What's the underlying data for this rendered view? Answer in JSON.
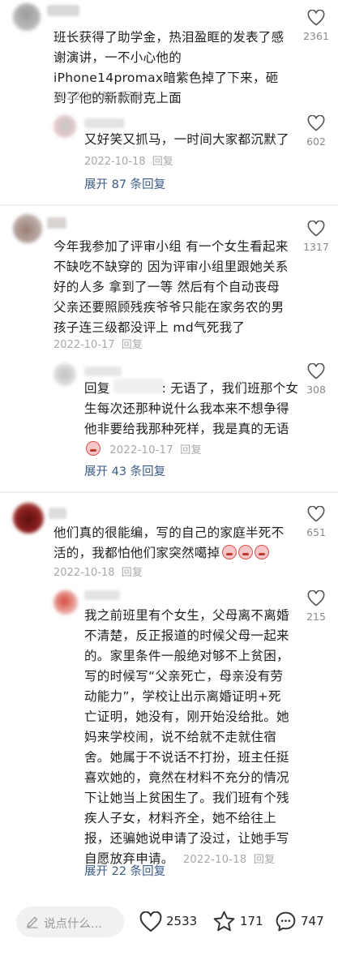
{
  "comments": [
    {
      "text": "班长获得了助学金，热泪盈眶的发表了感谢演讲，一不小心他的iPhone14promax暗紫色掉了下来，砸到了他的新款耐克上面",
      "date": "2022-10-18",
      "reply_label": "回复",
      "likes": "2361",
      "replies": [
        {
          "text": "又好笑又抓马，一时间大家都沉默了",
          "date": "2022-10-18",
          "reply_label": "回复",
          "likes": "602"
        }
      ],
      "expand_label": "展开 87 条回复"
    },
    {
      "text": "今年我参加了评审小组 有一个女生看起来不缺吃不缺穿的 因为评审小组里跟她关系好的人多 拿到了一等 然后有个自动丧母 父亲还要照顾残疾爷爷只能在家务农的男孩子连三级都没评上 md气死我了",
      "date": "2022-10-17",
      "reply_label": "回复",
      "likes": "1317",
      "replies": [
        {
          "prefix": "回复",
          "text": ": 无语了，我们班那个女生每次还那种说什么我本来不想争得他非要给我那种死样，我是真的无语",
          "date": "2022-10-17",
          "reply_label": "回复",
          "likes": "308"
        }
      ],
      "expand_label": "展开 43 条回复"
    },
    {
      "text": "他们真的很能编，写的自己的家庭半死不活的，我都怕他们家突然噶掉",
      "date": "2022-10-18",
      "reply_label": "回复",
      "likes": "651",
      "replies": [
        {
          "text": "我之前班里有个女生，父母离不离婚不清楚，反正报道的时候父母一起来的。家里条件一般绝对够不上贫困，写的时候写“父亲死亡，母亲没有劳动能力”，学校让出示离婚证明+死亡证明，她没有，刚开始没给批。她妈来学校闹，说不给就不走就住宿舍。她属于不说话不打扮，班主任挺喜欢她的，竟然在材料不充分的情况下让她当上贫困生了。我们班有个残疾人子女，材料齐全，她不给往上报，还骗她说申请了没过，让她手写自愿放弃申请。",
          "date": "2022-10-18",
          "reply_label": "回复",
          "likes": "215"
        }
      ],
      "expand_label": "展开 22 条回复"
    }
  ],
  "bottom_bar": {
    "input_placeholder": "说点什么...",
    "likes": "2533",
    "favorites": "171",
    "comments": "747"
  },
  "colors": {
    "accent_link": "#3c5b84",
    "meta_gray": "#a8a8a8"
  },
  "icons": [
    "heart-icon",
    "star-icon",
    "comment-icon",
    "pencil-icon",
    "crying-emoji"
  ]
}
